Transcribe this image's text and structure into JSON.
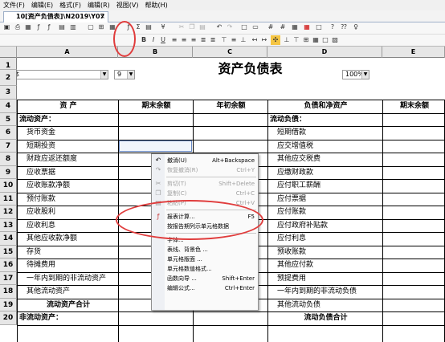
{
  "menubar": {
    "items": [
      "文件(F)",
      "编辑(E)",
      "格式(F)",
      "编辑(R)",
      "视图(V)",
      "帮助(H)"
    ]
  },
  "doc_tab": {
    "label": "10[资产负债表]\\N2019\\Y07",
    "close": "×"
  },
  "toolbar": {
    "font_name": "宋体",
    "font_size": "9",
    "zoom": "100%"
  },
  "columns": [
    "A",
    "B",
    "C",
    "D",
    "E"
  ],
  "rows": [
    {
      "n": "1",
      "a": "",
      "b": "",
      "c": "资产负债表",
      "d": "",
      "e": ""
    },
    {
      "n": "2",
      "a": "",
      "b": "",
      "c": "",
      "d": "",
      "e": ""
    },
    {
      "n": "3",
      "a": "",
      "b": "",
      "c": "",
      "d": "",
      "e": ""
    },
    {
      "n": "4",
      "a": "资       产",
      "b": "期末余额",
      "c": "年初余额",
      "d": "负债和净资产",
      "e": "期末余额"
    },
    {
      "n": "5",
      "a": "流动资产：",
      "b": "",
      "c": "",
      "d": "流动负债：",
      "e": ""
    },
    {
      "n": "6",
      "a": "货币资金",
      "b": "",
      "c": "",
      "d": "短期借款",
      "e": ""
    },
    {
      "n": "7",
      "a": "短期投资",
      "b": "",
      "c": "",
      "d": "应交增值税",
      "e": ""
    },
    {
      "n": "8",
      "a": "财政应返还额度",
      "b": "",
      "c": "",
      "d": "其他应交税费",
      "e": ""
    },
    {
      "n": "9",
      "a": "应收票据",
      "b": "",
      "c": "",
      "d": "应缴财政款",
      "e": ""
    },
    {
      "n": "10",
      "a": "应收账款净额",
      "b": "",
      "c": "",
      "d": "应付职工薪酬",
      "e": ""
    },
    {
      "n": "11",
      "a": "预付账款",
      "b": "",
      "c": "",
      "d": "应付票据",
      "e": ""
    },
    {
      "n": "12",
      "a": "应收股利",
      "b": "",
      "c": "",
      "d": "应付账款",
      "e": ""
    },
    {
      "n": "13",
      "a": "应收利息",
      "b": "",
      "c": "",
      "d": "应付政府补贴款",
      "e": ""
    },
    {
      "n": "14",
      "a": "其他应收款净额",
      "b": "",
      "c": "",
      "d": "应付利息",
      "e": ""
    },
    {
      "n": "15",
      "a": "存货",
      "b": "",
      "c": "",
      "d": "预收账款",
      "e": ""
    },
    {
      "n": "16",
      "a": "待摊费用",
      "b": "",
      "c": "",
      "d": "其他应付款",
      "e": ""
    },
    {
      "n": "17",
      "a": "一年内到期的非流动资产",
      "b": "",
      "c": "",
      "d": "预提费用",
      "e": ""
    },
    {
      "n": "18",
      "a": "其他流动资产",
      "b": "",
      "c": "",
      "d": "一年内到期的非流动负债",
      "e": ""
    },
    {
      "n": "19",
      "a": "流动资产合计",
      "b": "",
      "c": "",
      "d": "其他流动负债",
      "e": ""
    },
    {
      "n": "20",
      "a": "非流动资产：",
      "b": "",
      "c": "",
      "d": "流动负债合计",
      "e": ""
    }
  ],
  "context_menu": {
    "items": [
      {
        "label": "撤消(U)",
        "shortcut": "Alt+Backspace",
        "disabled": false,
        "icon": "undo-icon",
        "glyph": "↶"
      },
      {
        "label": "恢复撤消(R)",
        "shortcut": "Ctrl+Y",
        "disabled": true,
        "icon": "redo-icon",
        "glyph": "↷"
      },
      {
        "sep": true
      },
      {
        "label": "剪切(T)",
        "shortcut": "Shift+Delete",
        "disabled": true,
        "icon": "cut-icon",
        "glyph": "✂"
      },
      {
        "label": "复制(C)",
        "shortcut": "Ctrl+C",
        "disabled": true,
        "icon": "copy-icon",
        "glyph": "❐"
      },
      {
        "label": "粘贴(P)",
        "shortcut": "Ctrl+V",
        "disabled": true,
        "icon": "paste-icon",
        "glyph": "▤"
      },
      {
        "sep": true
      },
      {
        "label": "报表计算...",
        "shortcut": "F5",
        "disabled": false,
        "icon": "calculate-icon",
        "glyph": "ƒ"
      },
      {
        "label": "按报告期列示单元格数据",
        "shortcut": "",
        "disabled": false,
        "icon": "",
        "glyph": ""
      },
      {
        "sep": true
      },
      {
        "label": "字体...",
        "shortcut": "",
        "disabled": false,
        "icon": "",
        "glyph": ""
      },
      {
        "label": "表线、背景色 ...",
        "shortcut": "",
        "disabled": false,
        "icon": "",
        "glyph": ""
      },
      {
        "label": "单元格版面 ...",
        "shortcut": "",
        "disabled": false,
        "icon": "",
        "glyph": ""
      },
      {
        "label": "单元格数值格式...",
        "shortcut": "",
        "disabled": false,
        "icon": "",
        "glyph": ""
      },
      {
        "label": "函数向导 ...",
        "shortcut": "Shift+Enter",
        "disabled": false,
        "icon": "",
        "glyph": ""
      },
      {
        "label": "编辑公式...",
        "shortcut": "Ctrl+Enter",
        "disabled": false,
        "icon": "",
        "glyph": ""
      }
    ]
  }
}
